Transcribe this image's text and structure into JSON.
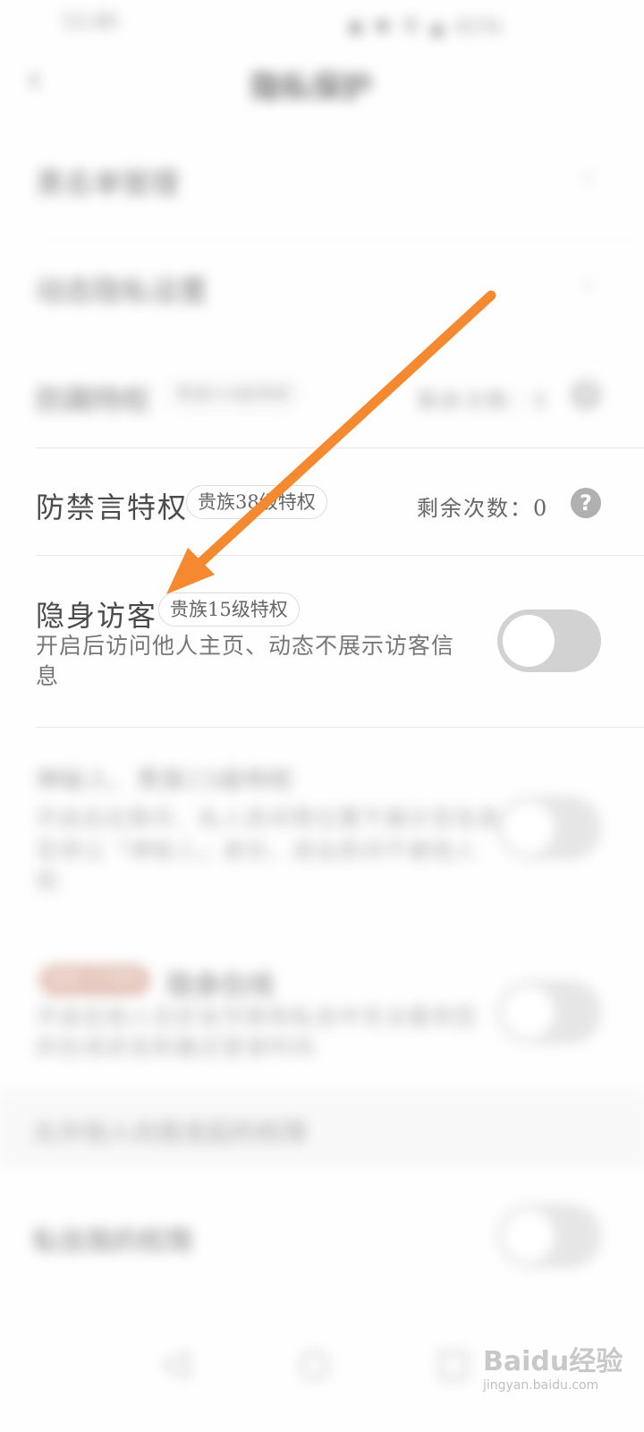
{
  "status_bar": {
    "time": "12:40",
    "icons": "◉ ✱ 令 ▲ 45%"
  },
  "header": {
    "title": "隐私保护"
  },
  "blurred_rows": {
    "row1": "黑名单管理",
    "row2": "动态隐私设置",
    "row3_title": "防踢特权",
    "row3_badge": "贵族50级特权",
    "row3_remain": "剩余次数：0"
  },
  "anti_mute": {
    "title": "防禁言特权",
    "badge": "贵族38级特权",
    "remain": "剩余次数：0",
    "help": "?"
  },
  "invisible_visitor": {
    "title": "隐身访客",
    "badge": "贵族15级特权",
    "desc_line1": "开启后访问他人主页、动态不展示访客信",
    "desc_line2": "息",
    "toggle_on": false
  },
  "blurred_feature_2": {
    "title": "神秘人、贵族15级特权",
    "desc_line1": "开启后在聊天、私人房间等位置不展示您信息",
    "desc_line2": "您将以「神秘人」身份，进出房间不被他人",
    "desc_line3": "知"
  },
  "blurred_feature_3": {
    "badge": "超级VIP特权",
    "title": "隐身在线",
    "desc_line1": "开启后他人在好友列表和私信中无法看到您",
    "desc_line2": "的在线状态和最近登录时间"
  },
  "section_header": "允许他人向我发起的权限",
  "blurred_row_4": "私信我的权限",
  "bottom_nav": {
    "left": "◁",
    "center": "○",
    "right": "□"
  },
  "watermark": {
    "main": "Baidu经验",
    "sub": "jingyan.baidu.com"
  },
  "colors": {
    "arrow": "#f5892f",
    "toggle_off": "#d2d2d2",
    "help_icon": "#b0b0b0"
  }
}
